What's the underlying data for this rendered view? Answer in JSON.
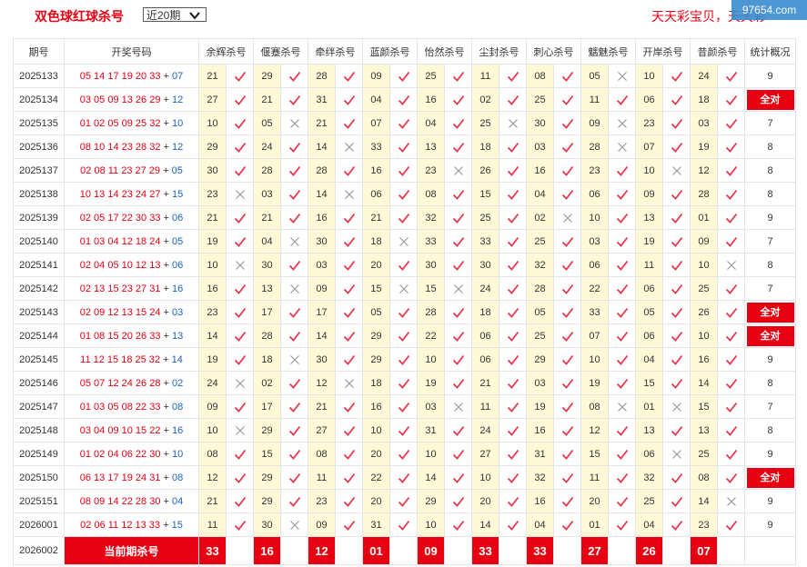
{
  "header": {
    "title": "双色球红球杀号",
    "select_value": "近20期",
    "site_name": "天天彩宝贝，天天彩",
    "watermark": "97654.com"
  },
  "columns": [
    "期号",
    "开奖号码",
    "余辉杀号",
    "偃蹇杀号",
    "牵绊杀号",
    "蓝颜杀号",
    "怡然杀号",
    "尘封杀号",
    "刺心杀号",
    "魑魅杀号",
    "开岸杀号",
    "昔颜杀号",
    "统计概况"
  ],
  "rows": [
    {
      "period": "2025133",
      "red": "05 14 17 19 20 33",
      "blue": "07",
      "kills": [
        [
          "21",
          1
        ],
        [
          "29",
          1
        ],
        [
          "28",
          1
        ],
        [
          "09",
          1
        ],
        [
          "25",
          1
        ],
        [
          "11",
          1
        ],
        [
          "08",
          1
        ],
        [
          "05",
          0
        ],
        [
          "10",
          1
        ],
        [
          "24",
          1
        ]
      ],
      "stat": "9"
    },
    {
      "period": "2025134",
      "red": "03 05 09 13 26 29",
      "blue": "12",
      "kills": [
        [
          "27",
          1
        ],
        [
          "21",
          1
        ],
        [
          "31",
          1
        ],
        [
          "04",
          1
        ],
        [
          "16",
          1
        ],
        [
          "02",
          1
        ],
        [
          "25",
          1
        ],
        [
          "11",
          1
        ],
        [
          "06",
          1
        ],
        [
          "18",
          1
        ]
      ],
      "stat": "全对"
    },
    {
      "period": "2025135",
      "red": "01 02 05 09 25 32",
      "blue": "10",
      "kills": [
        [
          "10",
          1
        ],
        [
          "05",
          0
        ],
        [
          "21",
          1
        ],
        [
          "07",
          1
        ],
        [
          "04",
          1
        ],
        [
          "25",
          0
        ],
        [
          "30",
          1
        ],
        [
          "09",
          0
        ],
        [
          "23",
          1
        ],
        [
          "03",
          1
        ]
      ],
      "stat": "7"
    },
    {
      "period": "2025136",
      "red": "08 10 14 23 28 32",
      "blue": "12",
      "kills": [
        [
          "29",
          1
        ],
        [
          "24",
          1
        ],
        [
          "14",
          0
        ],
        [
          "33",
          1
        ],
        [
          "13",
          1
        ],
        [
          "18",
          1
        ],
        [
          "03",
          1
        ],
        [
          "28",
          0
        ],
        [
          "07",
          1
        ],
        [
          "19",
          1
        ]
      ],
      "stat": "8"
    },
    {
      "period": "2025137",
      "red": "02 08 11 23 27 29",
      "blue": "05",
      "kills": [
        [
          "30",
          1
        ],
        [
          "28",
          1
        ],
        [
          "28",
          1
        ],
        [
          "16",
          1
        ],
        [
          "23",
          0
        ],
        [
          "26",
          1
        ],
        [
          "16",
          1
        ],
        [
          "23",
          1
        ],
        [
          "10",
          0
        ],
        [
          "12",
          1
        ]
      ],
      "stat": "8"
    },
    {
      "period": "2025138",
      "red": "10 13 14 23 24 27",
      "blue": "15",
      "kills": [
        [
          "23",
          0
        ],
        [
          "03",
          1
        ],
        [
          "14",
          0
        ],
        [
          "06",
          1
        ],
        [
          "08",
          1
        ],
        [
          "15",
          1
        ],
        [
          "04",
          1
        ],
        [
          "06",
          1
        ],
        [
          "09",
          1
        ],
        [
          "28",
          1
        ]
      ],
      "stat": "8"
    },
    {
      "period": "2025139",
      "red": "02 05 17 22 30 33",
      "blue": "06",
      "kills": [
        [
          "21",
          1
        ],
        [
          "21",
          1
        ],
        [
          "16",
          1
        ],
        [
          "21",
          1
        ],
        [
          "32",
          1
        ],
        [
          "25",
          1
        ],
        [
          "02",
          0
        ],
        [
          "10",
          1
        ],
        [
          "13",
          1
        ],
        [
          "01",
          1
        ]
      ],
      "stat": "9"
    },
    {
      "period": "2025140",
      "red": "01 03 04 12 18 24",
      "blue": "05",
      "kills": [
        [
          "19",
          1
        ],
        [
          "04",
          0
        ],
        [
          "30",
          1
        ],
        [
          "18",
          0
        ],
        [
          "33",
          1
        ],
        [
          "33",
          1
        ],
        [
          "25",
          1
        ],
        [
          "03",
          1
        ],
        [
          "19",
          1
        ],
        [
          "09",
          1
        ]
      ],
      "stat": "7"
    },
    {
      "period": "2025141",
      "red": "02 04 05 10 12 13",
      "blue": "06",
      "kills": [
        [
          "10",
          0
        ],
        [
          "30",
          1
        ],
        [
          "03",
          1
        ],
        [
          "20",
          1
        ],
        [
          "30",
          1
        ],
        [
          "30",
          1
        ],
        [
          "32",
          1
        ],
        [
          "06",
          1
        ],
        [
          "11",
          1
        ],
        [
          "10",
          0
        ]
      ],
      "stat": "8"
    },
    {
      "period": "2025142",
      "red": "02 13 15 23 27 31",
      "blue": "16",
      "kills": [
        [
          "16",
          1
        ],
        [
          "13",
          0
        ],
        [
          "09",
          1
        ],
        [
          "15",
          0
        ],
        [
          "15",
          0
        ],
        [
          "24",
          1
        ],
        [
          "28",
          1
        ],
        [
          "22",
          1
        ],
        [
          "06",
          1
        ],
        [
          "25",
          1
        ]
      ],
      "stat": "7"
    },
    {
      "period": "2025143",
      "red": "02 09 12 13 15 24",
      "blue": "03",
      "kills": [
        [
          "23",
          1
        ],
        [
          "17",
          1
        ],
        [
          "17",
          1
        ],
        [
          "05",
          1
        ],
        [
          "28",
          1
        ],
        [
          "18",
          1
        ],
        [
          "05",
          1
        ],
        [
          "33",
          1
        ],
        [
          "05",
          1
        ],
        [
          "26",
          1
        ]
      ],
      "stat": "全对"
    },
    {
      "period": "2025144",
      "red": "01 08 15 20 26 33",
      "blue": "13",
      "kills": [
        [
          "14",
          1
        ],
        [
          "28",
          1
        ],
        [
          "14",
          1
        ],
        [
          "29",
          1
        ],
        [
          "22",
          1
        ],
        [
          "06",
          1
        ],
        [
          "25",
          1
        ],
        [
          "07",
          1
        ],
        [
          "06",
          1
        ],
        [
          "10",
          1
        ]
      ],
      "stat": "全对"
    },
    {
      "period": "2025145",
      "red": "11 12 15 18 25 32",
      "blue": "14",
      "kills": [
        [
          "19",
          1
        ],
        [
          "18",
          0
        ],
        [
          "30",
          1
        ],
        [
          "29",
          1
        ],
        [
          "10",
          1
        ],
        [
          "06",
          1
        ],
        [
          "29",
          1
        ],
        [
          "10",
          1
        ],
        [
          "04",
          1
        ],
        [
          "16",
          1
        ]
      ],
      "stat": "9"
    },
    {
      "period": "2025146",
      "red": "05 07 12 24 26 28",
      "blue": "02",
      "kills": [
        [
          "24",
          0
        ],
        [
          "02",
          1
        ],
        [
          "12",
          0
        ],
        [
          "18",
          1
        ],
        [
          "19",
          1
        ],
        [
          "21",
          1
        ],
        [
          "03",
          1
        ],
        [
          "19",
          1
        ],
        [
          "15",
          1
        ],
        [
          "14",
          1
        ]
      ],
      "stat": "8"
    },
    {
      "period": "2025147",
      "red": "01 03 05 08 22 33",
      "blue": "08",
      "kills": [
        [
          "09",
          1
        ],
        [
          "17",
          1
        ],
        [
          "21",
          1
        ],
        [
          "16",
          1
        ],
        [
          "03",
          0
        ],
        [
          "11",
          1
        ],
        [
          "19",
          1
        ],
        [
          "08",
          0
        ],
        [
          "01",
          0
        ],
        [
          "15",
          1
        ]
      ],
      "stat": "7"
    },
    {
      "period": "2025148",
      "red": "03 04 09 10 15 22",
      "blue": "16",
      "kills": [
        [
          "10",
          0
        ],
        [
          "29",
          1
        ],
        [
          "27",
          1
        ],
        [
          "10",
          1
        ],
        [
          "31",
          1
        ],
        [
          "24",
          1
        ],
        [
          "16",
          1
        ],
        [
          "12",
          1
        ],
        [
          "13",
          1
        ],
        [
          "13",
          1
        ]
      ],
      "stat": "8"
    },
    {
      "period": "2025149",
      "red": "01 02 04 06 22 30",
      "blue": "10",
      "kills": [
        [
          "08",
          1
        ],
        [
          "15",
          1
        ],
        [
          "08",
          1
        ],
        [
          "20",
          1
        ],
        [
          "10",
          1
        ],
        [
          "27",
          1
        ],
        [
          "31",
          1
        ],
        [
          "15",
          1
        ],
        [
          "06",
          0
        ],
        [
          "25",
          1
        ]
      ],
      "stat": "9"
    },
    {
      "period": "2025150",
      "red": "06 13 17 19 24 31",
      "blue": "08",
      "kills": [
        [
          "12",
          1
        ],
        [
          "29",
          1
        ],
        [
          "11",
          1
        ],
        [
          "22",
          1
        ],
        [
          "14",
          1
        ],
        [
          "10",
          1
        ],
        [
          "32",
          1
        ],
        [
          "11",
          1
        ],
        [
          "32",
          1
        ],
        [
          "08",
          1
        ]
      ],
      "stat": "全对"
    },
    {
      "period": "2025151",
      "red": "08 09 14 22 28 30",
      "blue": "04",
      "kills": [
        [
          "21",
          1
        ],
        [
          "29",
          1
        ],
        [
          "23",
          1
        ],
        [
          "20",
          1
        ],
        [
          "29",
          1
        ],
        [
          "20",
          1
        ],
        [
          "16",
          1
        ],
        [
          "20",
          1
        ],
        [
          "25",
          1
        ],
        [
          "14",
          0
        ]
      ],
      "stat": "9"
    },
    {
      "period": "2026001",
      "red": "02 06 11 12 13 33",
      "blue": "15",
      "kills": [
        [
          "11",
          1
        ],
        [
          "30",
          0
        ],
        [
          "09",
          1
        ],
        [
          "31",
          1
        ],
        [
          "10",
          1
        ],
        [
          "14",
          1
        ],
        [
          "04",
          1
        ],
        [
          "01",
          1
        ],
        [
          "04",
          1
        ],
        [
          "23",
          1
        ]
      ],
      "stat": "9"
    }
  ],
  "current": {
    "period": "2026002",
    "label": "当前期杀号",
    "kills": [
      "33",
      "16",
      "12",
      "01",
      "09",
      "33",
      "33",
      "27",
      "26",
      "07"
    ]
  },
  "plus_sign": "+",
  "colors": {
    "red": "#e60012",
    "blue": "#1b63c6",
    "kill_bg": "#fff9d8",
    "ok_mark": "#e8364a",
    "bad_mark": "#9a9a9a"
  }
}
